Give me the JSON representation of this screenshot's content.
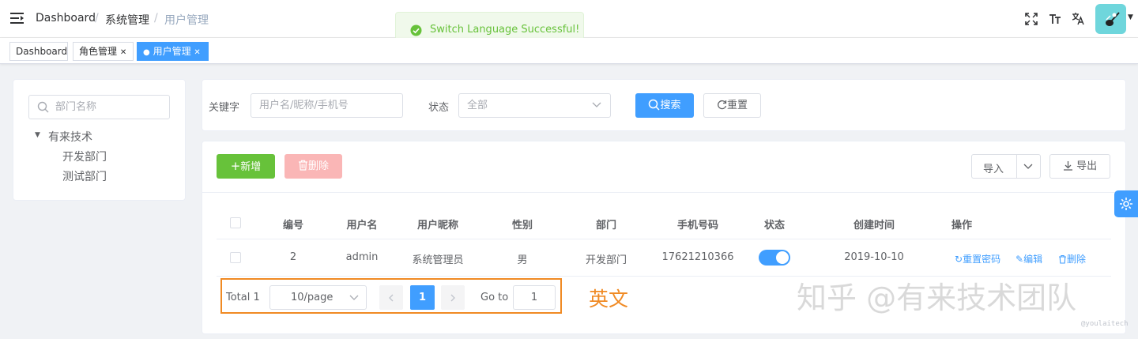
{
  "header": {
    "breadcrumbs": [
      "Dashboard",
      "系统管理",
      "用户管理"
    ],
    "separator": "/",
    "toast": "Switch Language Successful!"
  },
  "tags": [
    {
      "label": "Dashboard"
    },
    {
      "label": "角色管理",
      "close": "✕"
    },
    {
      "label": "用户管理",
      "close": "✕"
    }
  ],
  "dept_tree": {
    "search_placeholder": "部门名称",
    "root": "有来技术",
    "children": [
      "开发部门",
      "测试部门"
    ]
  },
  "search": {
    "keyword_label": "关键字",
    "keyword_placeholder": "用户名/昵称/手机号",
    "status_label": "状态",
    "status_placeholder": "全部",
    "search_btn": "搜索",
    "reset_btn": "重置"
  },
  "toolbar": {
    "add_btn": "新增",
    "delete_btn": "删除",
    "import_btn": "导入",
    "export_btn": "导出"
  },
  "table": {
    "headers": [
      "编号",
      "用户名",
      "用户昵称",
      "性别",
      "部门",
      "手机号码",
      "状态",
      "创建时间",
      "操作"
    ],
    "rows": [
      {
        "id": "2",
        "username": "admin",
        "nickname": "系统管理员",
        "gender": "男",
        "dept": "开发部门",
        "mobile": "17621210366",
        "status_on": true,
        "created": "2019-10-10"
      }
    ],
    "ops": {
      "reset_pwd": "重置密码",
      "edit": "编辑",
      "delete": "删除"
    }
  },
  "pagination": {
    "total": "Total 1",
    "page_size": "10/page",
    "current": "1",
    "goto_label": "Go to",
    "goto_value": "1"
  },
  "annotation": "英文",
  "watermark": {
    "main": "知乎 @有来技术团队",
    "sub": "@youlaitech"
  },
  "colors": {
    "primary": "#409eff",
    "success": "#67c23a",
    "danger_light": "#f89898",
    "highlight": "#f08a23"
  }
}
